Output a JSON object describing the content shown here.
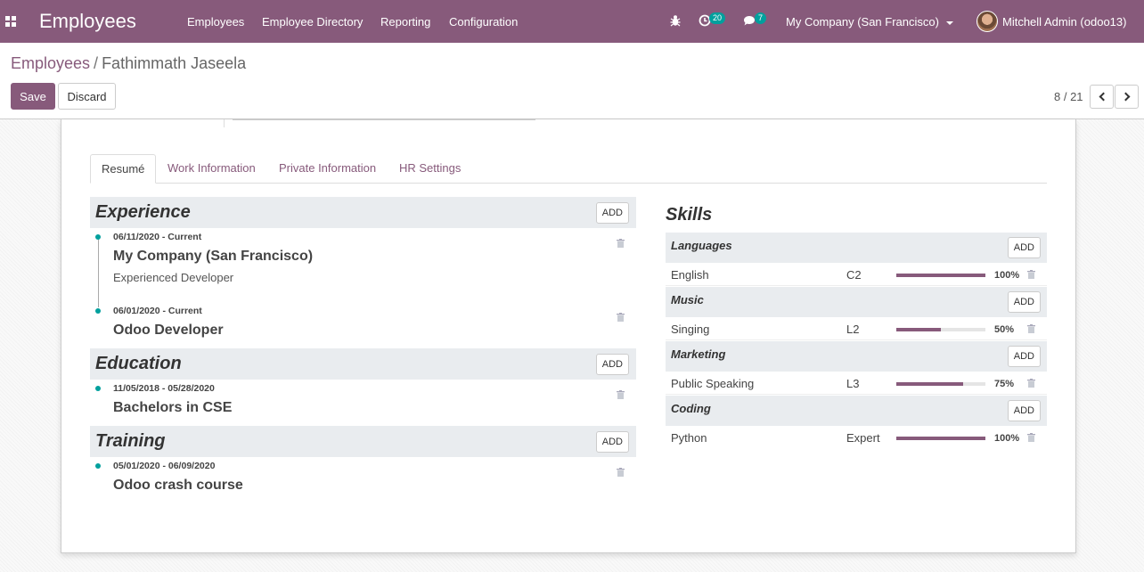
{
  "topbar": {
    "app_title": "Employees",
    "menu": [
      "Employees",
      "Employee Directory",
      "Reporting",
      "Configuration"
    ],
    "activity_count": "20",
    "message_count": "7",
    "company": "My Company (San Francisco)",
    "user": "Mitchell Admin (odoo13)"
  },
  "breadcrumb": {
    "parent": "Employees",
    "separator": "/",
    "current": "Fathimmath Jaseela"
  },
  "buttons": {
    "save": "Save",
    "discard": "Discard"
  },
  "pager": {
    "value": "8 / 21"
  },
  "tabs": [
    "Resumé",
    "Work Information",
    "Private Information",
    "HR Settings"
  ],
  "resume": {
    "add_label": "ADD",
    "sections": [
      {
        "title": "Experience",
        "lines": [
          {
            "date": "06/11/2020 - Current",
            "title": "My Company (San Francisco)",
            "description": "Experienced Developer"
          },
          {
            "date": "06/01/2020 - Current",
            "title": "Odoo Developer",
            "description": ""
          }
        ]
      },
      {
        "title": "Education",
        "lines": [
          {
            "date": "11/05/2018 - 05/28/2020",
            "title": "Bachelors in CSE",
            "description": ""
          }
        ]
      },
      {
        "title": "Training",
        "lines": [
          {
            "date": "05/01/2020 - 06/09/2020",
            "title": "Odoo crash course",
            "description": ""
          }
        ]
      }
    ]
  },
  "skills": {
    "title": "Skills",
    "add_label": "ADD",
    "groups": [
      {
        "name": "Languages",
        "skills": [
          {
            "name": "English",
            "level": "C2",
            "progress": 100,
            "progress_label": "100%"
          }
        ]
      },
      {
        "name": "Music",
        "skills": [
          {
            "name": "Singing",
            "level": "L2",
            "progress": 50,
            "progress_label": "50%"
          }
        ]
      },
      {
        "name": "Marketing",
        "skills": [
          {
            "name": "Public Speaking",
            "level": "L3",
            "progress": 75,
            "progress_label": "75%"
          }
        ]
      },
      {
        "name": "Coding",
        "skills": [
          {
            "name": "Python",
            "level": "Expert",
            "progress": 100,
            "progress_label": "100%"
          }
        ]
      }
    ]
  },
  "colors": {
    "brand": "#875a7b",
    "accent": "#00a09d"
  }
}
